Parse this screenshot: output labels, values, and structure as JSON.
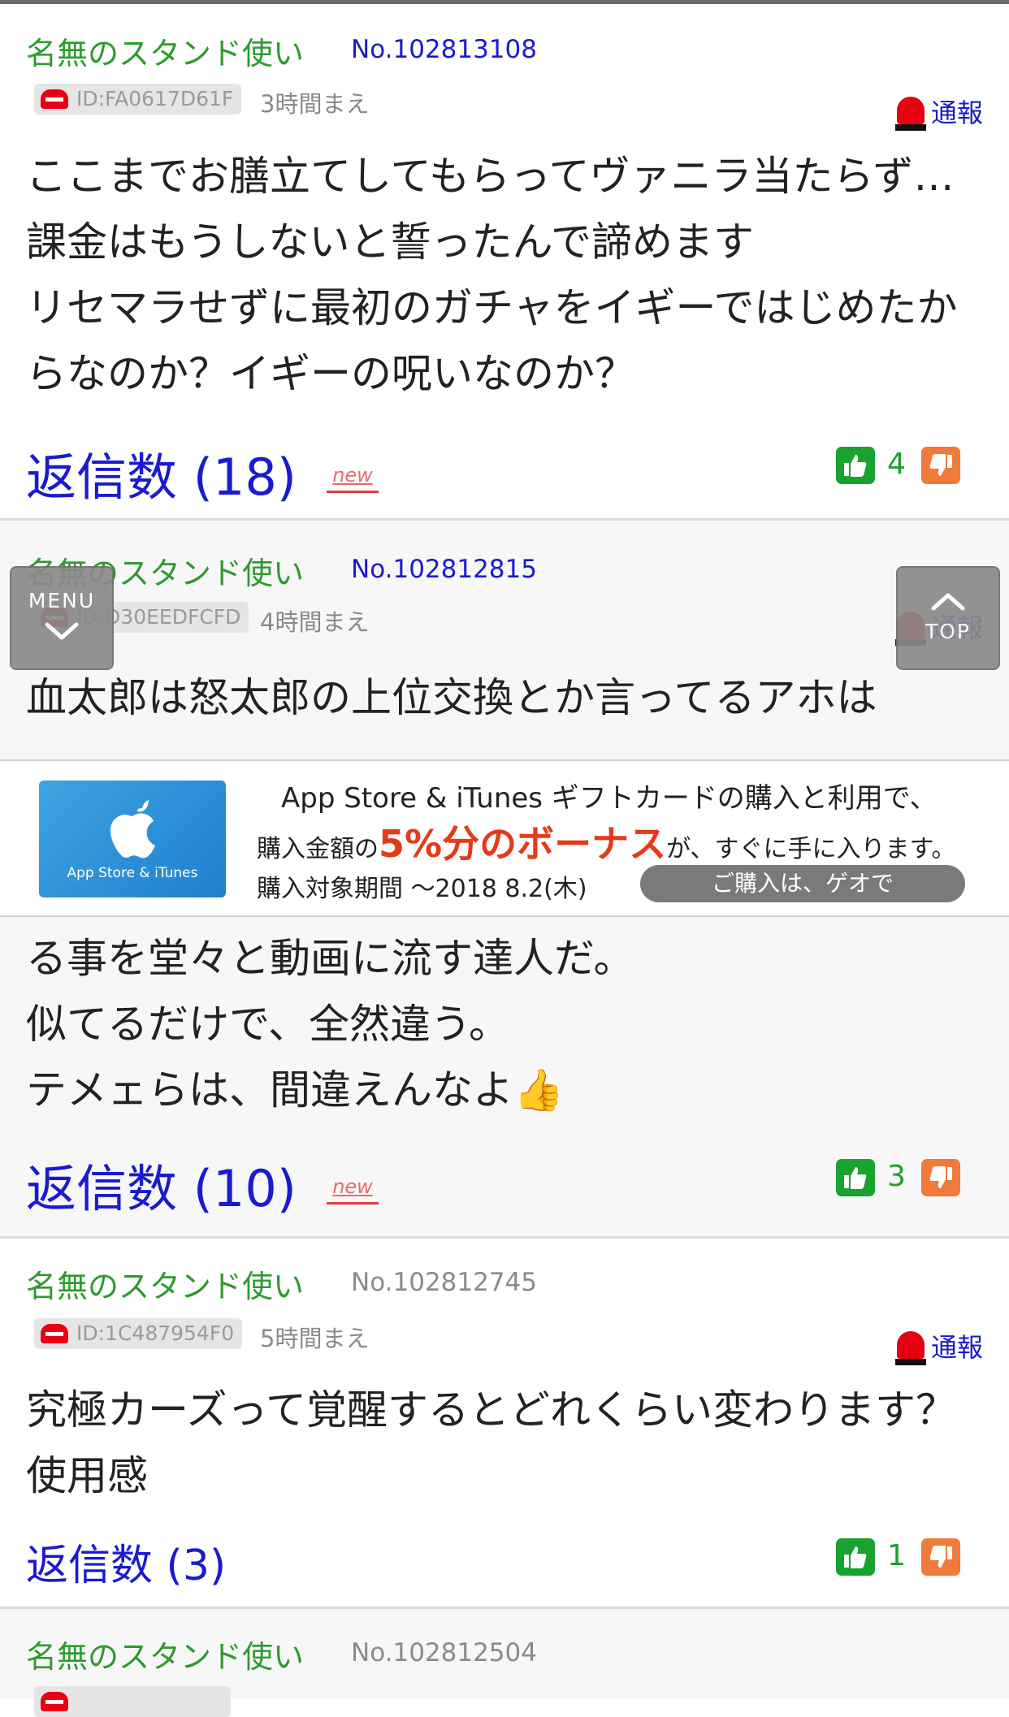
{
  "posts": [
    {
      "author": "名無のスタンド使い",
      "number": "No.102813108",
      "id": "ID:FA0617D61F",
      "time": "3時間まえ",
      "report": "通報",
      "body": "ここまでお膳立てしてもらってヴァニラ当たらず…課金はもうしないと誓ったんで諦めます\nリセマラせずに最初のガチャをイギーではじめたからなのか？イギーの呪いなのか？",
      "replies": "返信数 (18)",
      "new_badge": "new",
      "likes": "4"
    },
    {
      "author": "名無のスタンド使い",
      "number": "No.102812815",
      "id": "ID:D30EEDFCFD",
      "time": "4時間まえ",
      "report": "通報",
      "body_top": "血太郎は怒太郎の上位交換とか言ってるアホは",
      "body": "る事を堂々と動画に流す達人だ。\n似てるだけで、全然違う。\nテメェらは、間違えんなよ👍",
      "replies": "返信数 (10)",
      "new_badge": "new",
      "likes": "3"
    },
    {
      "author": "名無のスタンド使い",
      "number": "No.102812745",
      "id": "ID:1C487954F0",
      "time": "5時間まえ",
      "report": "通報",
      "body": "究極カーズって覚醒するとどれくらい変わります？\n使用感",
      "replies": "返信数 (3)",
      "likes": "1"
    },
    {
      "author": "名無のスタンド使い",
      "number": "No.102812504"
    }
  ],
  "floating": {
    "menu_label": "MENU",
    "top_label": "TOP"
  },
  "ad": {
    "card_label": "App Store & iTunes",
    "line1": "App Store & iTunes ギフトカードの購入と利用で、",
    "line2_pre": "購入金額の",
    "line2_highlight": "5%分のボーナス",
    "line2_post": "が、すぐに手に入ります。",
    "line3": "購入対象期間 〜2018 8.2(木)",
    "cta": "ご購入は、ゲオで"
  },
  "icons": {
    "id_badge": "no-entry-icon",
    "report": "siren-icon",
    "like": "thumbs-up-icon",
    "dislike": "thumbs-down-icon",
    "menu": "chevron-down-icon",
    "top": "chevron-up-icon",
    "ad_logo": "apple-logo-icon"
  },
  "colors": {
    "author": "#2e9a2e",
    "link": "#1a1ad0",
    "report": "#e60012",
    "like": "#19a22f",
    "dislike": "#f07a3a"
  }
}
